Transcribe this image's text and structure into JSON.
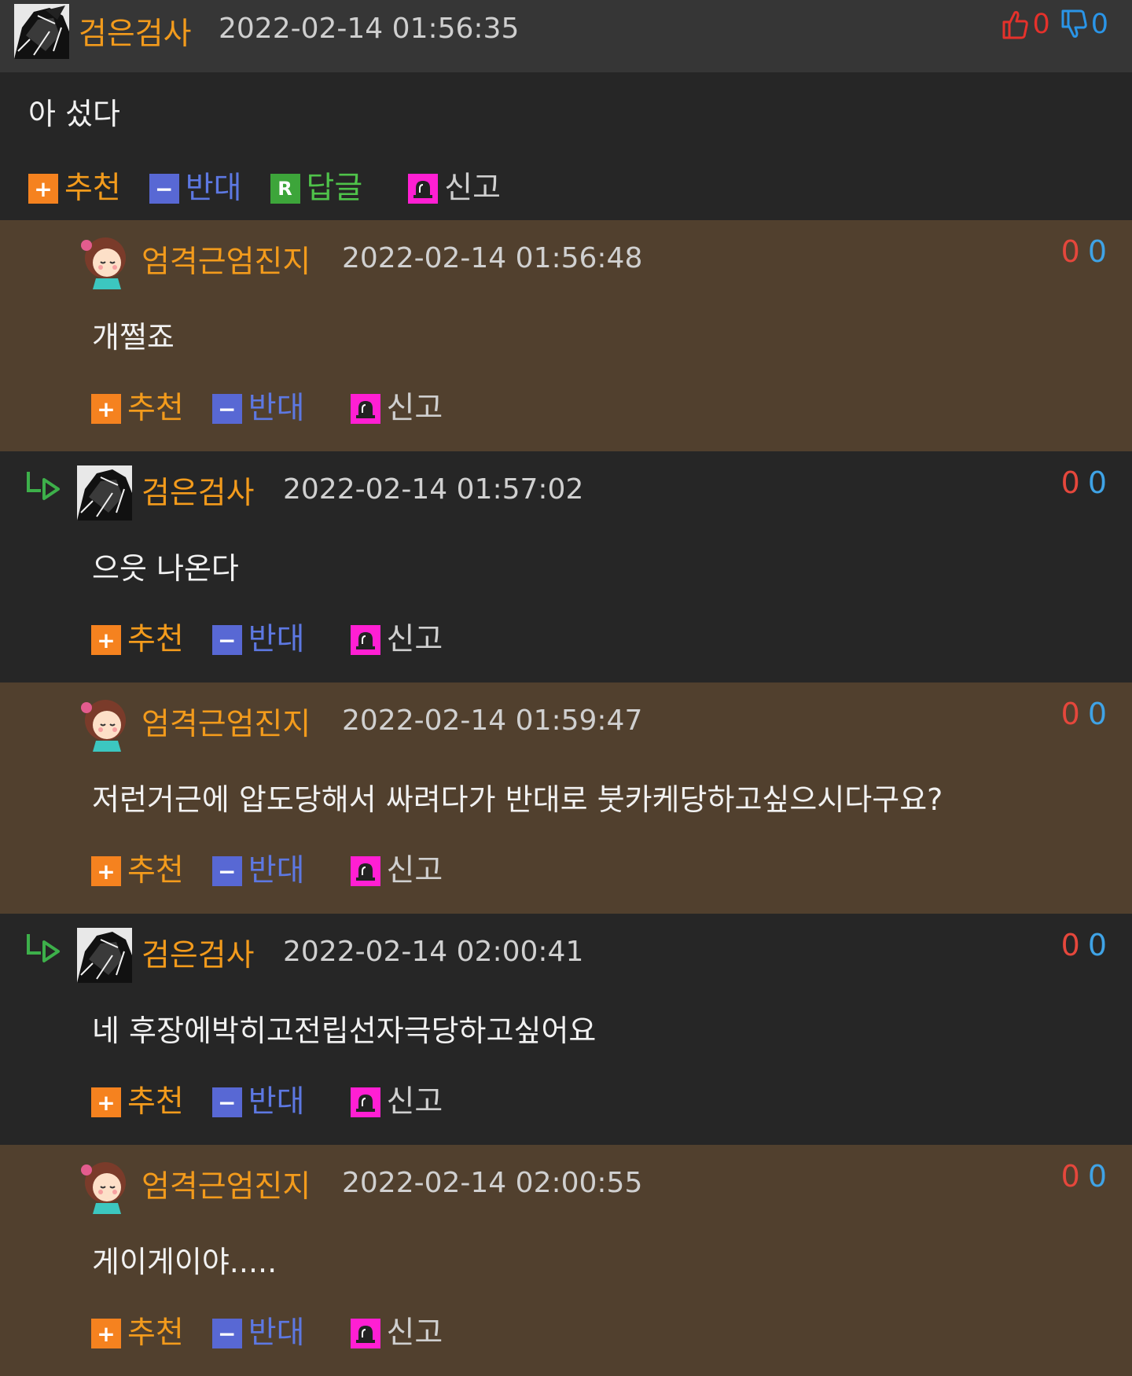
{
  "labels": {
    "recommend": "추천",
    "oppose": "반대",
    "reply": "답글",
    "report": "신고"
  },
  "main_comment": {
    "author": "검은검사",
    "date": "2022-02-14 01:56:35",
    "up_count": "0",
    "down_count": "0",
    "text": "아 섰다"
  },
  "replies": [
    {
      "author": "엄격근엄진지",
      "date": "2022-02-14 01:56:48",
      "up": "0",
      "down": "0",
      "text": "개쩔죠"
    },
    {
      "author": "검은검사",
      "date": "2022-02-14 01:57:02",
      "up": "0",
      "down": "0",
      "text": "으읏 나온다"
    },
    {
      "author": "엄격근엄진지",
      "date": "2022-02-14 01:59:47",
      "up": "0",
      "down": "0",
      "text": "저런거근에 압도당해서 싸려다가 반대로 붓카케당하고싶으시다구요?"
    },
    {
      "author": "검은검사",
      "date": "2022-02-14 02:00:41",
      "up": "0",
      "down": "0",
      "text": "네 후장에박히고전립선자극당하고싶어요"
    },
    {
      "author": "엄격근엄진지",
      "date": "2022-02-14 02:00:55",
      "up": "0",
      "down": "0",
      "text": "게이게이야....."
    }
  ],
  "icons": {
    "thumbs_up": "thumbs-up-icon",
    "thumbs_down": "thumbs-down-icon",
    "reply_arrow": "reply-arrow-icon",
    "siren": "siren-icon"
  },
  "colors": {
    "nickname": "#f39b1c",
    "recommend": "#f5821f",
    "oppose": "#5868d4",
    "reply": "#3da53a",
    "report": "#ff1fd3",
    "reply_bg_brown": "#51402e",
    "reply_bg_dark": "#262626"
  }
}
